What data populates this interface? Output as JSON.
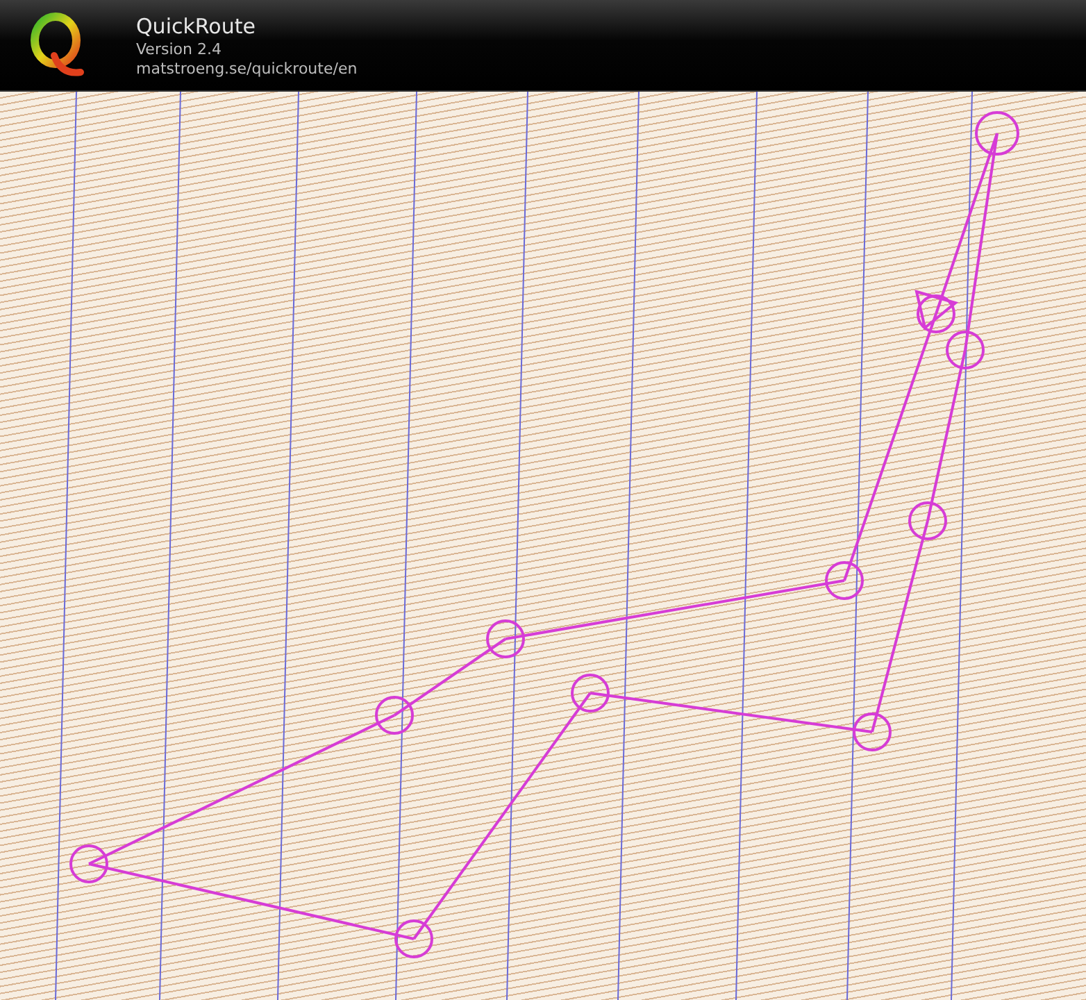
{
  "header": {
    "title": "QuickRoute",
    "version": "Version 2.4",
    "url": "matstroeng.se/quickroute/en"
  }
}
